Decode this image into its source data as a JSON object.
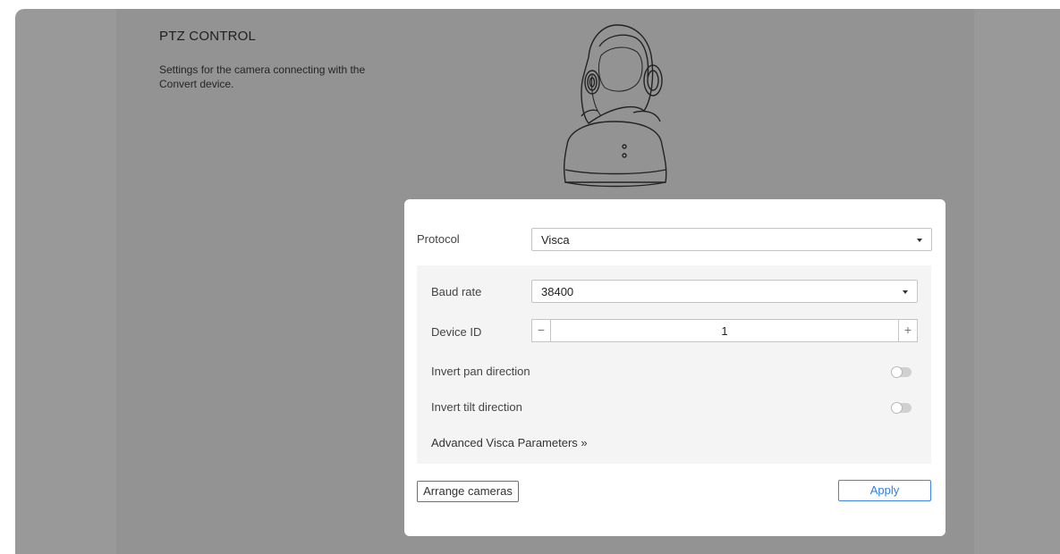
{
  "section": {
    "title": "PTZ CONTROL",
    "description": "Settings for the camera connecting with the Convert device."
  },
  "dialog": {
    "protocol_label": "Protocol",
    "protocol_value": "Visca",
    "baud_rate_label": "Baud rate",
    "baud_rate_value": "38400",
    "device_id_label": "Device ID",
    "device_id_value": "1",
    "minus_symbol": "−",
    "plus_symbol": "+",
    "invert_pan_label": "Invert pan direction",
    "invert_pan_on": false,
    "invert_tilt_label": "Invert tilt direction",
    "invert_tilt_on": false,
    "advanced_link": "Advanced Visca Parameters »",
    "arrange_button": "Arrange cameras",
    "apply_button": "Apply"
  },
  "colors": {
    "accent": "#2f7fe0",
    "overlay": "#999999"
  }
}
